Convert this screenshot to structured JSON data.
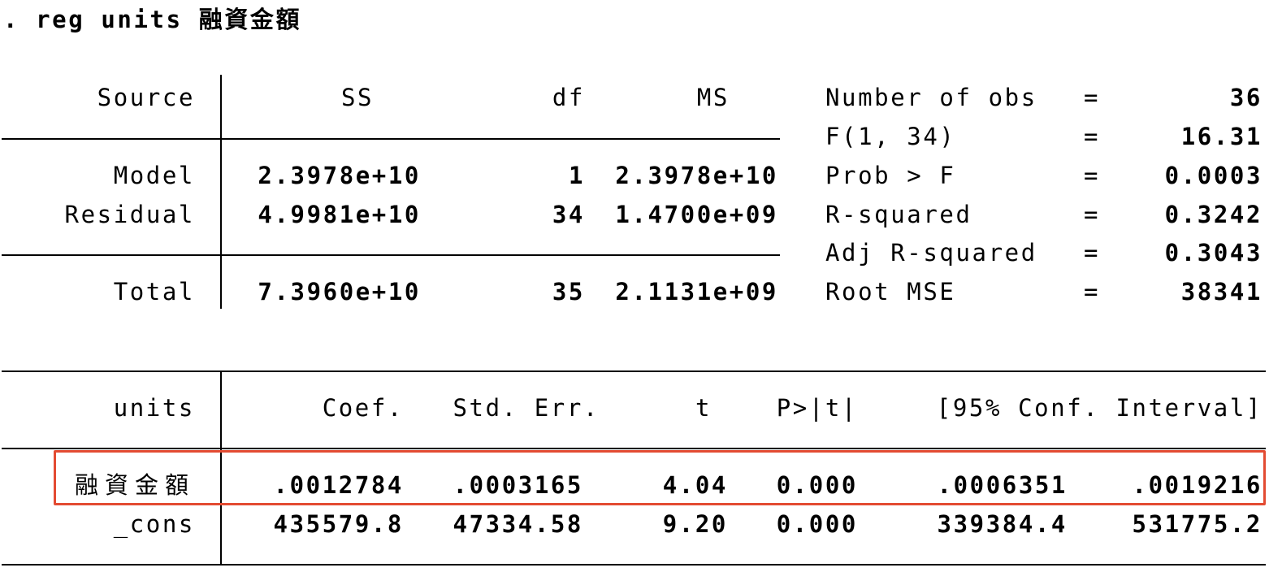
{
  "command": ". reg units 融資金額",
  "anova": {
    "headers": {
      "source": "Source",
      "ss": "SS",
      "df": "df",
      "ms": "MS"
    },
    "rows": [
      {
        "source": "Model",
        "ss": "2.3978e+10",
        "df": "1",
        "ms": "2.3978e+10"
      },
      {
        "source": "Residual",
        "ss": "4.9981e+10",
        "df": "34",
        "ms": "1.4700e+09"
      },
      {
        "source": "Total",
        "ss": "7.3960e+10",
        "df": "35",
        "ms": "2.1131e+09"
      }
    ]
  },
  "stats": [
    {
      "label": "Number of obs",
      "eq": "=",
      "value": "36"
    },
    {
      "label": "F(1, 34)",
      "eq": "=",
      "value": "16.31"
    },
    {
      "label": "Prob > F",
      "eq": "=",
      "value": "0.0003"
    },
    {
      "label": "R-squared",
      "eq": "=",
      "value": "0.3242"
    },
    {
      "label": "Adj R-squared",
      "eq": "=",
      "value": "0.3043"
    },
    {
      "label": "Root MSE",
      "eq": "=",
      "value": "38341"
    }
  ],
  "coef": {
    "headers": {
      "var": "units",
      "coef": "Coef.",
      "se": "Std. Err.",
      "t": "t",
      "p": "P>|t|",
      "ci": "[95% Conf. Interval]"
    },
    "rows": [
      {
        "var": "融資金額",
        "coef": ".0012784",
        "se": ".0003165",
        "t": "4.04",
        "p": "0.000",
        "lo": ".0006351",
        "hi": ".0019216",
        "highlighted": true
      },
      {
        "var": "_cons",
        "coef": "435579.8",
        "se": "47334.58",
        "t": "9.20",
        "p": "0.000",
        "lo": "339384.4",
        "hi": "531775.2",
        "highlighted": false
      }
    ]
  },
  "colors": {
    "highlight_box": "#e34b32"
  }
}
